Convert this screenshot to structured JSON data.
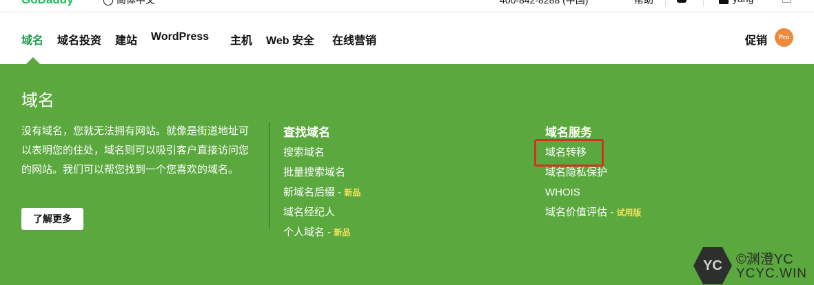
{
  "topbar": {
    "logo": "GoDaddy",
    "language": "简体中文",
    "phone": "400-842-8288 (中国)",
    "help": "帮助",
    "user": "yang"
  },
  "nav": {
    "items": [
      "域名",
      "域名投资",
      "建站",
      "WordPress",
      "主机",
      "Web 安全",
      "在线营销"
    ],
    "promo": "促销",
    "pro_badge": "Pro"
  },
  "panel": {
    "title": "域名",
    "description": "没有域名，您就无法拥有网站。就像是街道地址可以表明您的住处，域名则可以吸引客户直接访问您的网站。我们可以帮您找到一个您喜欢的域名。",
    "learn_more": "了解更多",
    "col1": {
      "heading": "查找域名",
      "links": [
        {
          "label": "搜索域名",
          "badge": ""
        },
        {
          "label": "批量搜索域名",
          "badge": ""
        },
        {
          "label": "新域名后缀 - ",
          "badge": "新品"
        },
        {
          "label": "域名经纪人",
          "badge": ""
        },
        {
          "label": "个人域名 - ",
          "badge": "新品"
        }
      ]
    },
    "col2": {
      "heading": "域名服务",
      "links": [
        {
          "label": "域名转移",
          "badge": ""
        },
        {
          "label": "域名隐私保护",
          "badge": ""
        },
        {
          "label": "WHOIS",
          "badge": ""
        },
        {
          "label": "域名价值评估 - ",
          "badge": "试用版"
        }
      ]
    }
  },
  "watermark": {
    "hex_text": "YC",
    "line1": "©渊澄YC",
    "line2": "YCYC.WIN"
  },
  "colors": {
    "panel_green": "#5aa83e",
    "active_nav": "#1f9a4c",
    "badge_yellow": "#f7e45b",
    "highlight_red": "#d4321f",
    "pro_orange": "#ef8a3c"
  }
}
